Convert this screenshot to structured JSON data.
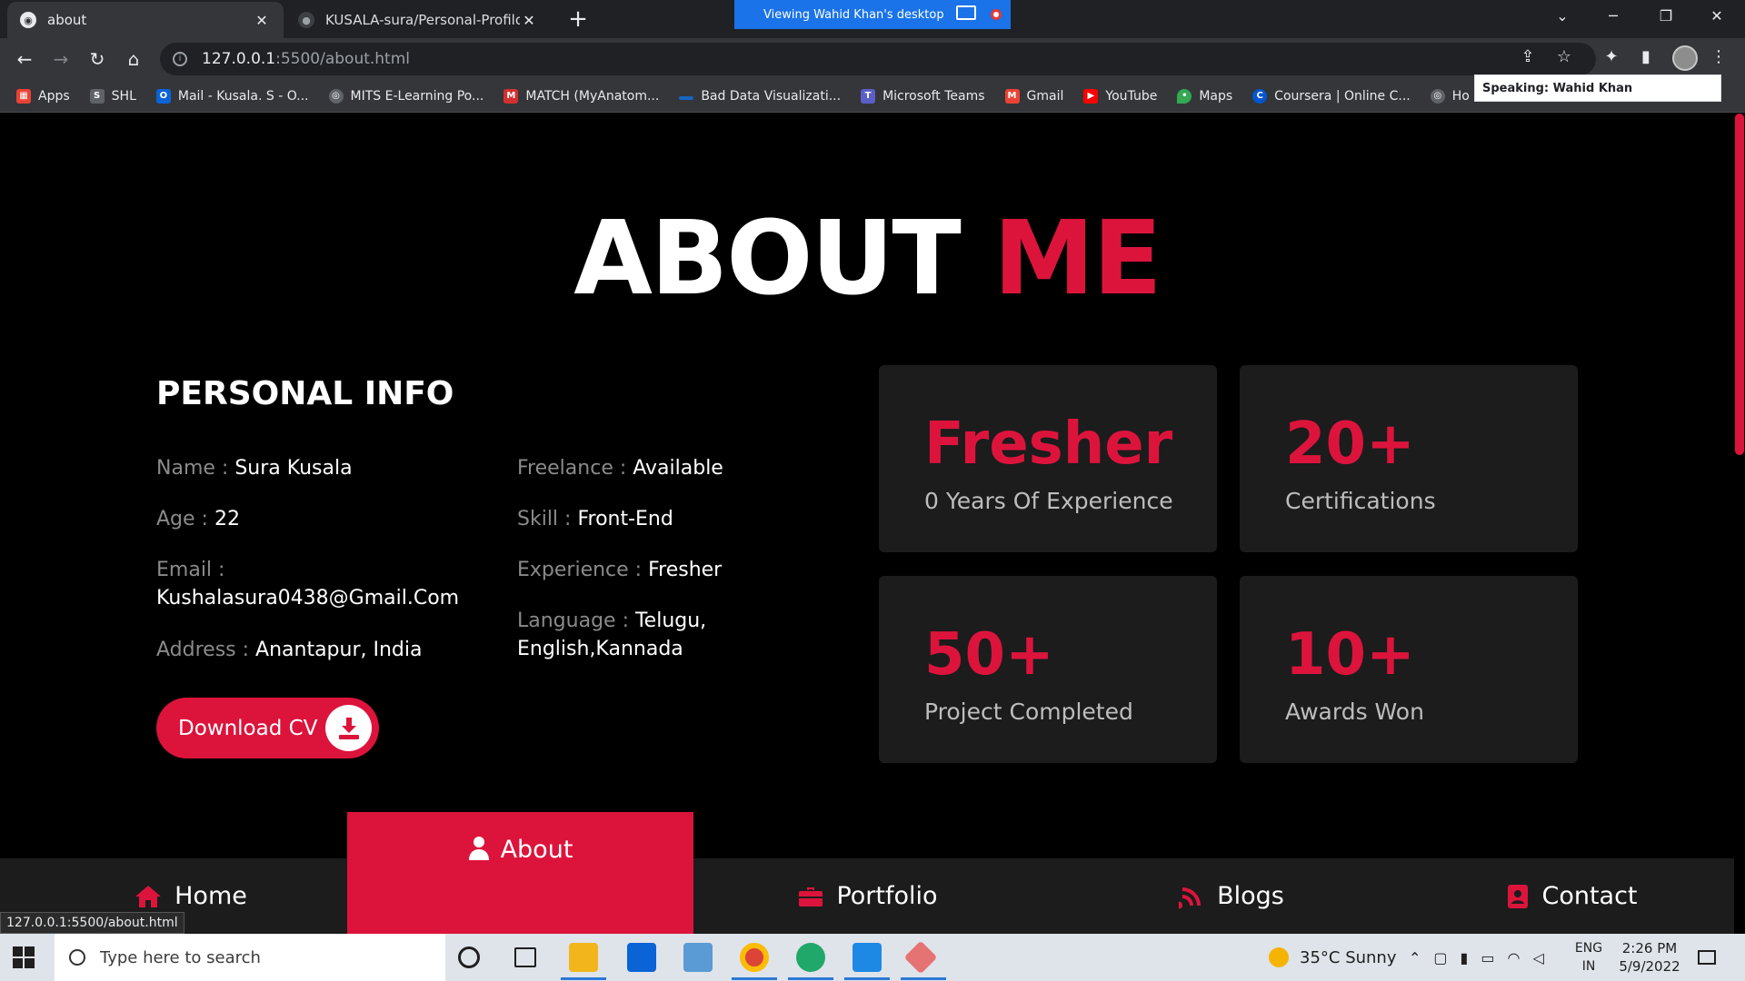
{
  "browser": {
    "tabs": [
      {
        "title": "about",
        "active": true
      },
      {
        "title": "KUSALA-sura/Personal-Profilo-Fo",
        "active": false
      }
    ],
    "share_banner": "Viewing Wahid Khan's desktop",
    "url_host": "127.0.0.1",
    "url_path": ":5500/about.html",
    "speaking": "Speaking: Wahid Khan",
    "bookmarks": [
      {
        "label": "Apps",
        "icon": "apps-grid-icon",
        "color": "#ea4335"
      },
      {
        "label": "SHL",
        "icon": "shl-icon",
        "color": "#5f6368"
      },
      {
        "label": "Mail - Kusala. S - O...",
        "icon": "outlook-icon",
        "color": "#0a64d6"
      },
      {
        "label": "MITS E-Learning Po...",
        "icon": "globe-icon",
        "color": "#5f6368"
      },
      {
        "label": "MATCH (MyAnatom...",
        "icon": "match-icon",
        "color": "#d32f2f"
      },
      {
        "label": "Bad Data Visualizati...",
        "icon": "dash-icon",
        "color": "#1565c0"
      },
      {
        "label": "Microsoft Teams",
        "icon": "teams-icon",
        "color": "#5b5fc7"
      },
      {
        "label": "Gmail",
        "icon": "gmail-icon",
        "color": "#ea4335"
      },
      {
        "label": "YouTube",
        "icon": "youtube-icon",
        "color": "#ff0000"
      },
      {
        "label": "Maps",
        "icon": "maps-icon",
        "color": "#34a853"
      },
      {
        "label": "Coursera | Online C...",
        "icon": "coursera-icon",
        "color": "#0056d2"
      },
      {
        "label": "Ho",
        "icon": "globe-icon",
        "color": "#5f6368"
      }
    ]
  },
  "page": {
    "heading_main": "ABOUT",
    "heading_accent": "ME",
    "personal_info_title": "PERSONAL INFO",
    "info": {
      "name": {
        "label": "Name :",
        "value": "Sura Kusala"
      },
      "age": {
        "label": "Age :",
        "value": "22"
      },
      "email": {
        "label": "Email :",
        "value": "Kushalasura0438@Gmail.Com"
      },
      "address": {
        "label": "Address :",
        "value": "Anantapur, India"
      },
      "freelance": {
        "label": "Freelance :",
        "value": "Available"
      },
      "skill": {
        "label": "Skill :",
        "value": "Front-End"
      },
      "experience": {
        "label": "Experience :",
        "value": "Fresher"
      },
      "language": {
        "label": "Language :",
        "value_line1": "Telugu,",
        "value_line2": "English,Kannada"
      }
    },
    "download_cv": "Download CV",
    "stats": [
      {
        "number": "Fresher",
        "label": "0 Years Of Experience"
      },
      {
        "number": "20+",
        "label": "Certifications"
      },
      {
        "number": "50+",
        "label": "Project Completed"
      },
      {
        "number": "10+",
        "label": "Awards Won"
      }
    ],
    "nav": {
      "home": "Home",
      "about": "About",
      "portfolio": "Portfolio",
      "blogs": "Blogs",
      "contact": "Contact"
    },
    "status_url": "127.0.0.1:5500/about.html",
    "accent_color": "#dc143c"
  },
  "taskbar": {
    "search_placeholder": "Type here to search",
    "weather": "35°C  Sunny",
    "lang_line1": "ENG",
    "lang_line2": "IN",
    "time": "2:26 PM",
    "date": "5/9/2022"
  }
}
